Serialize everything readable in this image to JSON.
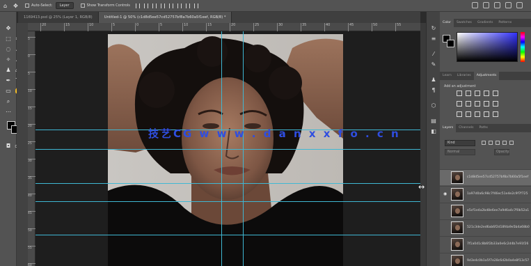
{
  "options_bar": {
    "auto_select_label": "Auto-Select:",
    "auto_select_value": "Layer",
    "show_transform_label": "Show Transform Controls"
  },
  "tabs": [
    {
      "label": "1169413.psd @ 25% (Layer 1, RGB/8)",
      "active": false
    },
    {
      "label": "Untitled-1 @ 50% (c1d8d5ee57cd52757bf8a7b60a5f1eef, RGB/8) *",
      "active": true
    }
  ],
  "ruler_h": [
    "20",
    "15",
    "10",
    "5",
    "0",
    "5",
    "10",
    "15",
    "20",
    "25",
    "30",
    "35",
    "40",
    "45",
    "50",
    "55"
  ],
  "ruler_v": [
    "5",
    "0",
    "5",
    "10",
    "15",
    "20",
    "25",
    "30",
    "35",
    "40",
    "45",
    "50",
    "55",
    "60"
  ],
  "watermark": "技艺CG  w w w . d a n x x f o . c n",
  "panels": {
    "color_tabs": [
      {
        "label": "Color",
        "active": true
      },
      {
        "label": "Swatches",
        "active": false
      },
      {
        "label": "Gradients",
        "active": false
      },
      {
        "label": "Patterns",
        "active": false
      }
    ],
    "adjust_tabs": [
      {
        "label": "Learn",
        "active": false
      },
      {
        "label": "Libraries",
        "active": false
      },
      {
        "label": "Adjustments",
        "active": true
      }
    ],
    "adjust_title": "Add an adjustment",
    "layer_tabs": [
      {
        "label": "Layers",
        "active": true
      },
      {
        "label": "Channels",
        "active": false
      },
      {
        "label": "Paths",
        "active": false
      }
    ],
    "kind_label": "Kind",
    "blend_mode": "Normal",
    "opacity_label": "Opacity:"
  },
  "layers": [
    {
      "name": "c1d8d5ee57cd52757bf8a7b60a5f1eef",
      "selected": true,
      "visible": false
    },
    {
      "name": "1a97d0a6c98c7f46ec51e4e2c9f7f725",
      "selected": false,
      "visible": true
    },
    {
      "name": "e5cf1e4a2bd8e6ee7a9d6a4c7f0b52a1",
      "selected": false,
      "visible": false
    },
    {
      "name": "521c3de2ed6ab6f2d18fda9e5b4a68b0",
      "selected": false,
      "visible": false
    },
    {
      "name": "7f1a0d1c8b6f2b33a0e6c2d4b7e91f26",
      "selected": false,
      "visible": false
    },
    {
      "name": "9d3e4c0b1a5f7e28c6d2b0a4e8f13c57",
      "selected": false,
      "visible": false
    }
  ],
  "colors": {
    "guide": "#3fb8d4",
    "watermark": "#2f4ee0"
  }
}
